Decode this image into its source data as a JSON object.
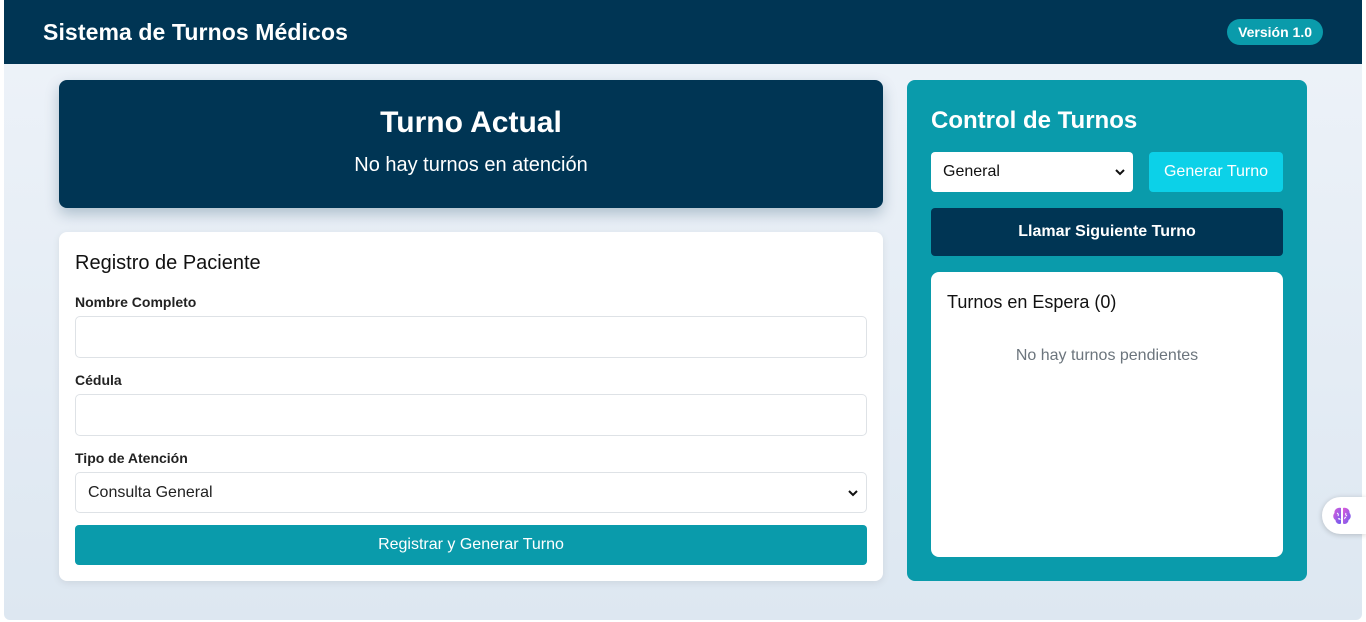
{
  "navbar": {
    "title": "Sistema de Turnos Médicos",
    "version": "Versión 1.0"
  },
  "current_turn": {
    "title": "Turno Actual",
    "status": "No hay turnos en atención"
  },
  "register": {
    "title": "Registro de Paciente",
    "name_label": "Nombre Completo",
    "name_value": "",
    "id_label": "Cédula",
    "id_value": "",
    "type_label": "Tipo de Atención",
    "type_value": "Consulta General",
    "submit_label": "Registrar y Generar Turno"
  },
  "control": {
    "title": "Control de Turnos",
    "type_value": "General",
    "generate_label": "Generar Turno",
    "next_label": "Llamar Siguiente Turno",
    "queue_title": "Turnos en Espera (0)",
    "queue_empty": "No hay turnos pendientes"
  },
  "icons": {
    "chevron": "chevron-down-icon",
    "widget": "brain-icon"
  },
  "colors": {
    "primary_dark": "#003554",
    "teal": "#0a9bab",
    "cyan": "#0cd1e8"
  }
}
